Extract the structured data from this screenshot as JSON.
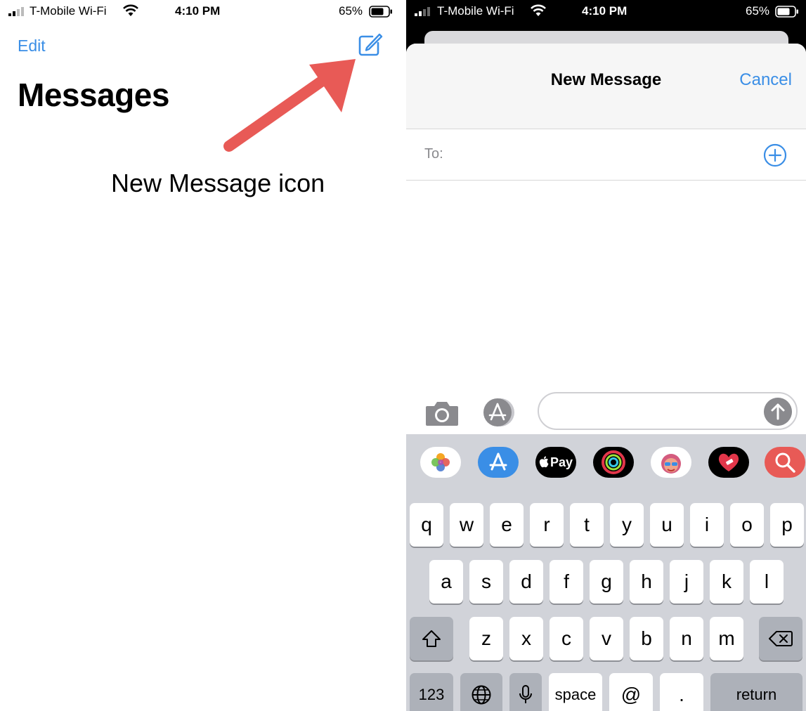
{
  "left": {
    "status": {
      "carrier": "T-Mobile Wi-Fi",
      "time": "4:10 PM",
      "battery": "65%"
    },
    "nav": {
      "edit_label": "Edit",
      "compose_icon": "compose-icon"
    },
    "title": "Messages",
    "annotation": {
      "text": "New Message icon",
      "color": "#e85a56"
    }
  },
  "right": {
    "status": {
      "carrier": "T-Mobile Wi-Fi",
      "time": "4:10 PM",
      "battery": "65%"
    },
    "sheet": {
      "title": "New Message",
      "cancel_label": "Cancel"
    },
    "to_field": {
      "label": "To:",
      "add_icon": "plus-circle-icon"
    },
    "input_bar": {
      "camera_icon": "camera-icon",
      "apps_icon": "app-store-icon",
      "message_value": "",
      "send_icon": "send-arrow-icon"
    },
    "app_strip": [
      {
        "name": "photos-app-icon"
      },
      {
        "name": "app-store-icon"
      },
      {
        "name": "apple-pay-icon",
        "label": "Pay"
      },
      {
        "name": "activity-app-icon"
      },
      {
        "name": "memoji-app-icon"
      },
      {
        "name": "digital-touch-app-icon"
      },
      {
        "name": "images-search-app-icon"
      }
    ],
    "keyboard": {
      "row1": [
        "q",
        "w",
        "e",
        "r",
        "t",
        "y",
        "u",
        "i",
        "o",
        "p"
      ],
      "row2": [
        "a",
        "s",
        "d",
        "f",
        "g",
        "h",
        "j",
        "k",
        "l"
      ],
      "row3": [
        "z",
        "x",
        "c",
        "v",
        "b",
        "n",
        "m"
      ],
      "numbers_label": "123",
      "space_label": "space",
      "at_label": "@",
      "dot_label": ".",
      "return_label": "return",
      "accent": "#3a8ee6"
    }
  }
}
